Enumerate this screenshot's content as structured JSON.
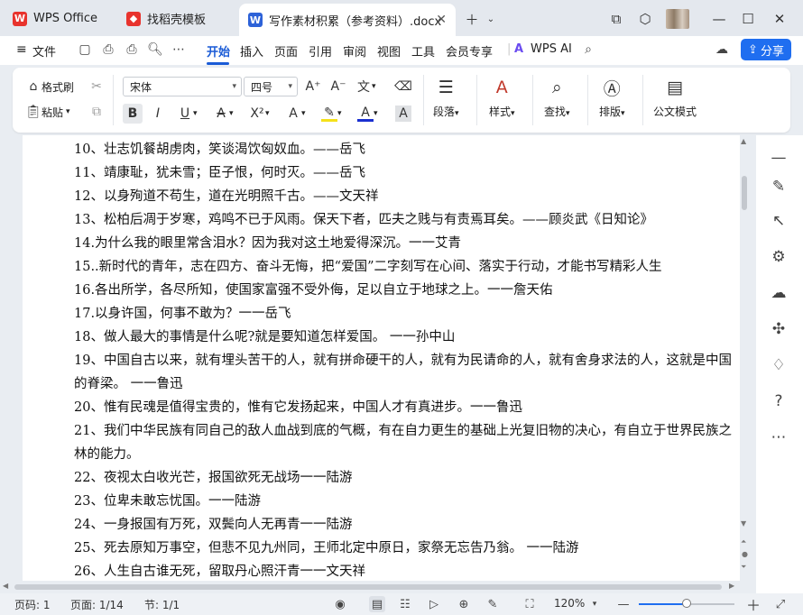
{
  "window": {
    "tabs": [
      {
        "label": "WPS Office",
        "icon": "wps-logo-icon"
      },
      {
        "label": "找稻壳模板",
        "icon": "daoke-icon"
      },
      {
        "label": "写作素材积累（参考资料）.docx",
        "icon": "word-doc-icon"
      }
    ],
    "colors": {
      "wps_red": "#e8332d",
      "doc_blue": "#2d62d8",
      "accent": "#1f6ef0"
    }
  },
  "menubar": {
    "file_label": "文件",
    "items": [
      "开始",
      "插入",
      "页面",
      "引用",
      "审阅",
      "视图",
      "工具",
      "会员专享"
    ],
    "active": "开始",
    "wps_ai_label": "WPS AI",
    "share_label": "分享"
  },
  "ribbon": {
    "format_painter": "格式刷",
    "paste": "粘贴",
    "font_name": "宋体",
    "font_size": "四号",
    "paragraph": "段落",
    "style": "样式",
    "find": "查找",
    "layout": "排版",
    "official_doc": "公文模式"
  },
  "document": {
    "paragraphs": [
      "10、壮志饥餐胡虏肉，笑谈渴饮匈奴血。——岳飞",
      "11、靖康耻，犹未雪；臣子恨，何时灭。——岳飞",
      "12、以身殉道不苟生，道在光明照千古。——文天祥",
      "13、松柏后凋于岁寒，鸡鸣不已于风雨。保天下者，匹夫之贱与有责焉耳矣。——顾炎武《日知论》",
      "14.为什么我的眼里常含泪水？因为我对这土地爱得深沉。一一艾青",
      "15..新时代的青年，志在四方、奋斗无悔，把“爱国”二字刻写在心间、落实于行动，才能书写精彩人生",
      "16.各出所学，各尽所知，使国家富强不受外侮，足以自立于地球之上。一一詹天佑",
      "17.以身许国，何事不敢为？一一岳飞",
      "18、做人最大的事情是什么呢?就是要知道怎样爱国。  一一孙中山",
      "19、中国自古以来，就有埋头苦干的人，就有拼命硬干的人，就有为民请命的人，就有舍身求法的人，这就是中国",
      "的脊梁。  一一鲁迅",
      "20、惟有民魂是值得宝贵的，惟有它发扬起来，中国人才有真进步。一一鲁迅",
      "21、我们中华民族有同自己的敌人血战到底的气概，有在自力更生的基础上光复旧物的决心，有自立于世界民族之",
      "林的能力。",
      "22、夜视太白收光芒，报国欲死无战场一一陆游",
      "23、位卑未敢忘忧国。一一陆游",
      "24、一身报国有万死，双鬓向人无再青一一陆游",
      "25、死去原知万事空，但悲不见九州同，王师北定中原日，家祭无忘告乃翁。  一一陆游",
      "26、人生自古谁无死，留取丹心照汗青一一文天祥"
    ]
  },
  "statusbar": {
    "page_no": "页码: 1",
    "page_count": "页面: 1/14",
    "section": "节: 1/1",
    "zoom": "120%",
    "zoom_level": 0.5
  }
}
